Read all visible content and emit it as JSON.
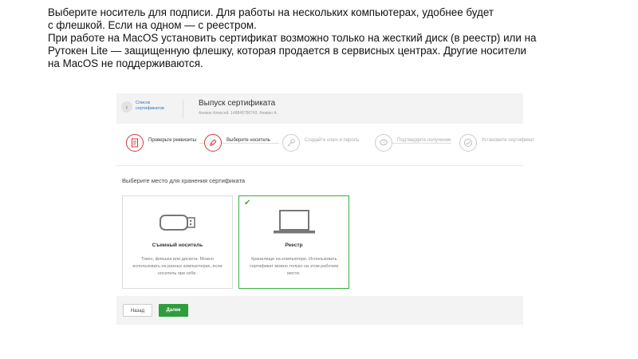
{
  "intro": {
    "line1": "Выберите носитель для подписи. Для работы на нескольких компьютерах, удобнее будет",
    "line2": "с флешкой. Если на одном — с реестром.",
    "line3": "При работе на MacOS установить сертификат возможно только на жесткий диск (в реестр) или на",
    "line4": "Рутокен Lite — защищенную флешку, которая продается в сервисных центрах. Другие носители",
    "line5": "на MacOS не поддерживаются."
  },
  "header": {
    "back_label": "Список сертификатов",
    "title": "Выпуск сертификата",
    "subtitle": "Аникин Алексей. 148849750743. Аникин А."
  },
  "steps": [
    {
      "label": "Проверьте реквизиты",
      "icon": "document-icon",
      "active": true
    },
    {
      "label": "Выберите носитель",
      "icon": "usb-key-icon",
      "active": true
    },
    {
      "label": "Создайте ключ и пароль",
      "icon": "key-icon",
      "active": false
    },
    {
      "label": "Подтвердите получение",
      "icon": "chat-icon",
      "active": false
    },
    {
      "label": "Установите сертификат",
      "icon": "check-circle-icon",
      "active": false
    }
  ],
  "section_title": "Выберите место для хранения сертификата",
  "cards": [
    {
      "title": "Съемный носитель",
      "desc": "Токен, флешка или дискета. Можно использовать на разных компьютерах, если носитель при себе.",
      "icon": "usb-flash-icon",
      "selected": false
    },
    {
      "title": "Реестр",
      "desc": "Хранилище на компьютере. Использовать сертификат можно только на этом рабочем месте.",
      "icon": "monitor-icon",
      "selected": true
    }
  ],
  "check_mark": "✔",
  "footer": {
    "back_label": "Назад",
    "next_label": "Далее"
  },
  "colors": {
    "accent_red": "#d0343f",
    "accent_green": "#37b13a",
    "button_green": "#2f9d3b",
    "link_blue": "#2e77b8"
  }
}
